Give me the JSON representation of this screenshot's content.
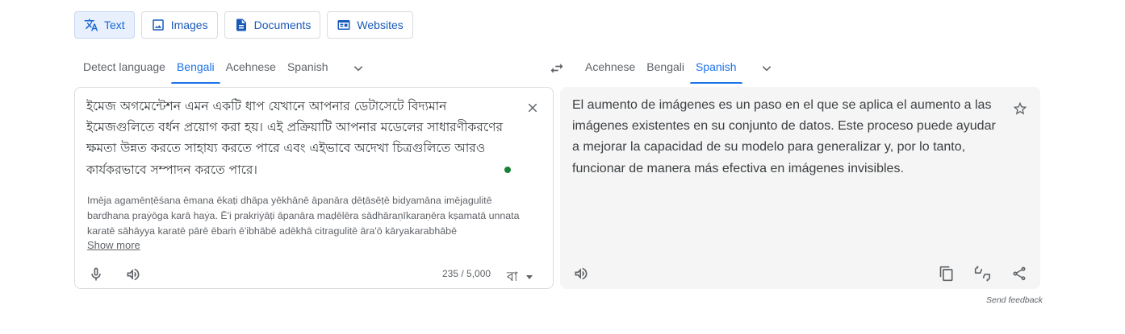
{
  "modes": [
    {
      "label": "Text",
      "icon": "translate-icon",
      "active": true
    },
    {
      "label": "Images",
      "icon": "image-icon",
      "active": false
    },
    {
      "label": "Documents",
      "icon": "document-icon",
      "active": false
    },
    {
      "label": "Websites",
      "icon": "website-icon",
      "active": false
    }
  ],
  "source_langs": [
    "Detect language",
    "Bengali",
    "Acehnese",
    "Spanish"
  ],
  "source_active": "Bengali",
  "target_langs": [
    "Acehnese",
    "Bengali",
    "Spanish"
  ],
  "target_active": "Spanish",
  "source": {
    "text": "ইমেজ অগমেন্টেশন এমন একটি ধাপ যেখানে আপনার ডেটাসেটে বিদ্যমান ইমেজগুলিতে বর্ধন প্রয়োগ করা হয়। এই প্রক্রিয়াটি আপনার মডেলের সাধারণীকরণের ক্ষমতা উন্নত করতে সাহায্য করতে পারে এবং এইভাবে অদেখা চিত্রগুলিতে আরও কার্যকরভাবে সম্পাদন করতে পারে।",
    "transliteration": "Imēja agamēnṭēśana ēmana ēkaṭi dhāpa yēkhānē āpanāra ḍēṭāsēṭē bidyamāna imējagulitē bardhana praẏōga karā haẏa. Ē'i prakriẏāṭi āpanāra maḍēlēra sādhāraṇīkaraṇēra kṣamatā unnata karatē sāhāyya karatē pārē ēbaṁ ē'ibhābē adēkhā citragulitē āra'ō kāryakarabhābē",
    "show_more": "Show more",
    "char_count": "235 / 5,000",
    "ime_label": "বা"
  },
  "target": {
    "text": "El aumento de imágenes es un paso en el que se aplica el aumento a las imágenes existentes en su conjunto de datos. Este proceso puede ayudar a mejorar la capacidad de su modelo para generalizar y, por lo tanto, funcionar de manera más efectiva en imágenes invisibles."
  },
  "send_feedback": "Send feedback",
  "colors": {
    "accent": "#1a73e8",
    "active_bg": "#e8f0fe",
    "panel_bg": "#f5f5f5",
    "dot": "#188038"
  }
}
